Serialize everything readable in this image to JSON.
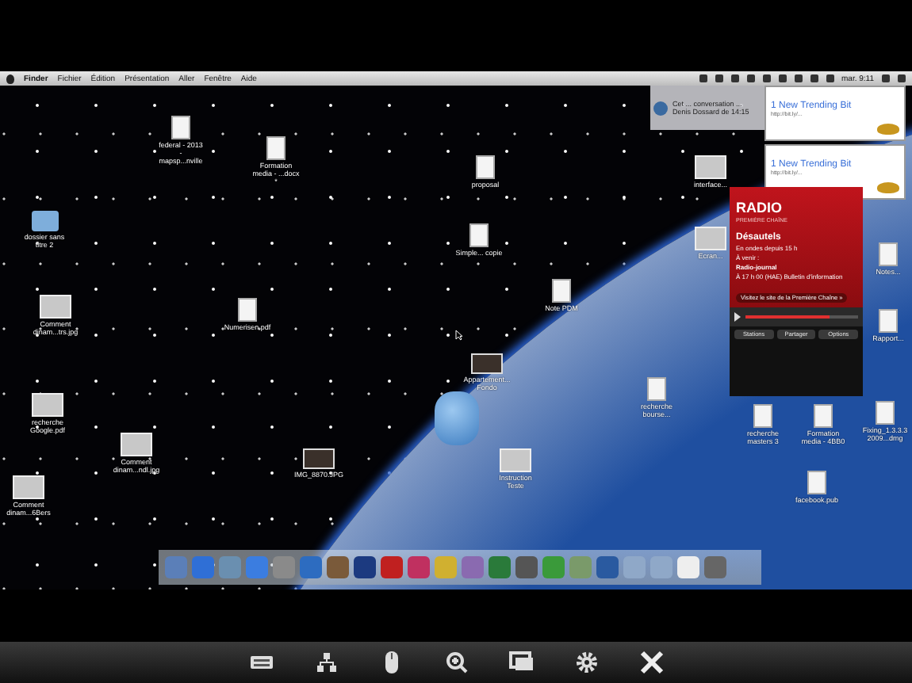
{
  "menu_bar": {
    "items": [
      "Finder",
      "Fichier",
      "Édition",
      "Présentation",
      "Aller",
      "Fenêtre",
      "Aide"
    ],
    "clock": "mar. 9:11"
  },
  "desktop_icons": [
    {
      "kind": "doc",
      "label": "federal - 2013 - mapsp...nville"
    },
    {
      "kind": "doc",
      "label": "Formation media - ...docx *"
    },
    {
      "kind": "doc",
      "label": "proposal"
    },
    {
      "kind": "folder",
      "label": "dossier sans titre 2"
    },
    {
      "kind": "doc",
      "label": "Simple... copie"
    },
    {
      "kind": "image",
      "label": "Comment dinam...trs.jpg"
    },
    {
      "kind": "doc",
      "label": "Numerisen.pdf"
    },
    {
      "kind": "doc",
      "label": "Note PDM"
    },
    {
      "kind": "photo",
      "label": "Appartement... Fondo"
    },
    {
      "kind": "image",
      "label": "recherche Google.pdf"
    },
    {
      "kind": "image",
      "label": "Comment dinam...ndl.jpg"
    },
    {
      "kind": "image",
      "label": "Comment dinam...6Bers"
    },
    {
      "kind": "photo",
      "label": "IMG_8870.JPG"
    },
    {
      "kind": "image",
      "label": "Instruction Teste"
    },
    {
      "kind": "image",
      "label": "interface..."
    },
    {
      "kind": "image",
      "label": "Ecran..."
    },
    {
      "kind": "doc",
      "label": "Notes..."
    },
    {
      "kind": "doc",
      "label": "Rapport..."
    },
    {
      "kind": "doc",
      "label": "recherche bourse..."
    },
    {
      "kind": "doc",
      "label": "recherche masters 3"
    },
    {
      "kind": "doc",
      "label": "Formation media - 4BB0"
    },
    {
      "kind": "doc",
      "label": "Fixing_1.3.3.3 2009...dmg"
    },
    {
      "kind": "doc",
      "label": "facebook.pub"
    }
  ],
  "event_alert": {
    "text": "Cet ... conversation ... Denis Dossard de 14:15"
  },
  "notifications": [
    {
      "title": "1 New Trending Bit",
      "link": "http://bit.ly/..."
    },
    {
      "title": "1 New Trending Bit",
      "link": "http://bit.ly/..."
    }
  ],
  "radio_widget": {
    "logo": "RADIO",
    "network": "PREMIÈRE CHAÎNE",
    "show": "Désautels",
    "on_air": "En ondes depuis 15 h",
    "upcoming_label": "À venir :",
    "upcoming_show": "Radio-journal",
    "upcoming_detail": "À 17 h 00 (HAE) Bulletin d'information",
    "site_link": "Visitez le site de la Première Chaîne »",
    "volume": {
      "level": 0.75
    },
    "buttons": [
      "Stations",
      "Partager",
      "Options"
    ]
  },
  "dock": [
    {
      "color": "#5b7fb8"
    },
    {
      "color": "#2f6fd6"
    },
    {
      "color": "#6a8fb0"
    },
    {
      "color": "#3b7de0"
    },
    {
      "color": "#8a8a8a"
    },
    {
      "color": "#2d6cc0"
    },
    {
      "color": "#7a5a3a"
    },
    {
      "color": "#1c3a80"
    },
    {
      "color": "#c02020"
    },
    {
      "color": "#c03060"
    },
    {
      "color": "#d0b030"
    },
    {
      "color": "#8a6ab0"
    },
    {
      "color": "#2a7a3a"
    },
    {
      "color": "#555555"
    },
    {
      "color": "#3a9a3a"
    },
    {
      "color": "#7a9a6a"
    },
    {
      "color": "#2a5aa0"
    },
    {
      "color": "#8fa8c8"
    },
    {
      "color": "#8fa8c8"
    },
    {
      "color": "#eeeeee"
    },
    {
      "color": "#666666"
    }
  ],
  "toolbar": [
    {
      "kind": "keyboard"
    },
    {
      "kind": "network"
    },
    {
      "kind": "mouse"
    },
    {
      "kind": "zoom"
    },
    {
      "kind": "screens"
    },
    {
      "kind": "settings"
    },
    {
      "kind": "close"
    }
  ]
}
